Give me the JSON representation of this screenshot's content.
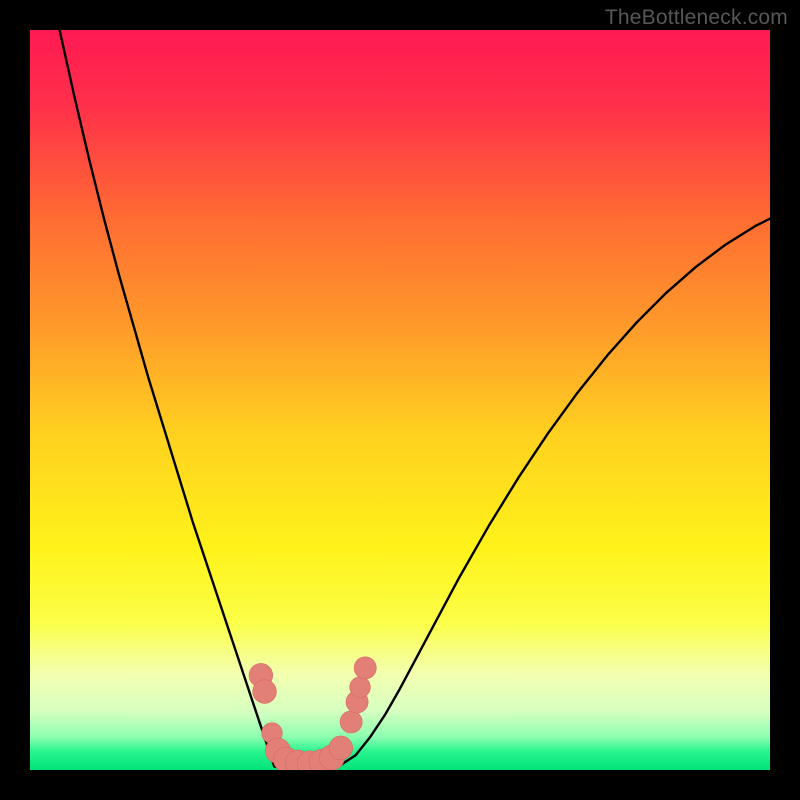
{
  "watermark": "TheBottleneck.com",
  "colors": {
    "frame": "#000000",
    "curve": "#000000",
    "marker_fill": "#e27f77",
    "marker_stroke": "#d96a62",
    "gradient_stops": [
      {
        "offset": 0.0,
        "color": "#ff1a52"
      },
      {
        "offset": 0.1,
        "color": "#ff2f4a"
      },
      {
        "offset": 0.25,
        "color": "#ff6a33"
      },
      {
        "offset": 0.4,
        "color": "#ff9a2a"
      },
      {
        "offset": 0.55,
        "color": "#ffd21f"
      },
      {
        "offset": 0.7,
        "color": "#fff21a"
      },
      {
        "offset": 0.8,
        "color": "#fbff47"
      },
      {
        "offset": 0.87,
        "color": "#f3ffb0"
      },
      {
        "offset": 0.92,
        "color": "#d7ffc0"
      },
      {
        "offset": 0.955,
        "color": "#8dffb0"
      },
      {
        "offset": 0.975,
        "color": "#29f58f"
      },
      {
        "offset": 1.0,
        "color": "#00e37a"
      }
    ]
  },
  "chart_data": {
    "type": "line",
    "title": "",
    "xlabel": "",
    "ylabel": "",
    "xlim": [
      0,
      100
    ],
    "ylim": [
      0,
      100
    ],
    "grid": false,
    "legend": false,
    "series": [
      {
        "name": "left-branch",
        "x": [
          4.0,
          6.0,
          8.0,
          10.0,
          12.0,
          14.0,
          16.0,
          18.0,
          20.0,
          22.0,
          24.0,
          26.0,
          28.0,
          29.0,
          30.0,
          31.0,
          32.0,
          33.0
        ],
        "y": [
          100.0,
          91.0,
          82.5,
          74.5,
          67.0,
          60.0,
          53.0,
          46.5,
          40.0,
          33.5,
          27.5,
          21.5,
          15.5,
          12.5,
          9.5,
          6.5,
          3.5,
          0.5
        ]
      },
      {
        "name": "valley-floor",
        "x": [
          33.0,
          34.0,
          35.0,
          36.0,
          37.0,
          38.0,
          39.0,
          40.0,
          41.0,
          42.0
        ],
        "y": [
          0.5,
          0.2,
          0.1,
          0.05,
          0.05,
          0.05,
          0.1,
          0.2,
          0.4,
          0.7
        ]
      },
      {
        "name": "right-branch",
        "x": [
          42.0,
          44.0,
          46.0,
          48.0,
          50.0,
          54.0,
          58.0,
          62.0,
          66.0,
          70.0,
          74.0,
          78.0,
          82.0,
          86.0,
          90.0,
          94.0,
          98.0,
          100.0
        ],
        "y": [
          0.7,
          2.0,
          4.5,
          7.5,
          11.0,
          18.5,
          26.0,
          33.0,
          39.5,
          45.5,
          51.0,
          56.0,
          60.5,
          64.5,
          68.0,
          71.0,
          73.5,
          74.5
        ]
      }
    ],
    "markers": [
      {
        "x": 31.2,
        "y": 12.8,
        "r": 1.6
      },
      {
        "x": 31.7,
        "y": 10.6,
        "r": 1.6
      },
      {
        "x": 32.7,
        "y": 5.0,
        "r": 1.4
      },
      {
        "x": 33.5,
        "y": 2.6,
        "r": 1.7
      },
      {
        "x": 34.6,
        "y": 1.4,
        "r": 1.7
      },
      {
        "x": 36.2,
        "y": 1.0,
        "r": 1.7
      },
      {
        "x": 37.8,
        "y": 0.9,
        "r": 1.7
      },
      {
        "x": 39.4,
        "y": 1.1,
        "r": 1.7
      },
      {
        "x": 40.8,
        "y": 1.7,
        "r": 1.7
      },
      {
        "x": 42.0,
        "y": 3.0,
        "r": 1.6
      },
      {
        "x": 43.4,
        "y": 6.5,
        "r": 1.5
      },
      {
        "x": 44.2,
        "y": 9.2,
        "r": 1.5
      },
      {
        "x": 44.6,
        "y": 11.2,
        "r": 1.4
      },
      {
        "x": 45.3,
        "y": 13.8,
        "r": 1.5
      }
    ]
  }
}
